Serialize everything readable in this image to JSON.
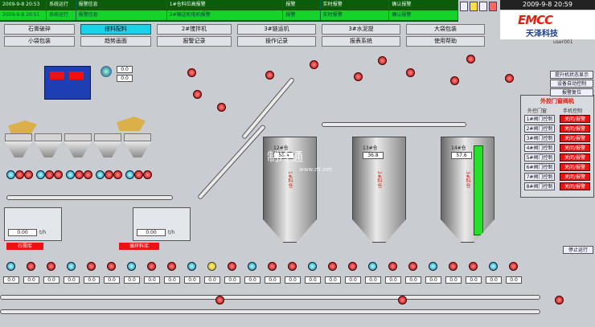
{
  "alarm_rows": [
    [
      "2009-9-8 20:53",
      "系统运行",
      "报警信息",
      "1#仓料位高报警",
      "报警",
      "实时报警",
      "确认报警"
    ],
    [
      "2009-9-8 20:51",
      "系统运行",
      "报警信息",
      "2#输送机电机报警",
      "报警",
      "实时报警",
      "确认报警"
    ]
  ],
  "clock": "2009-9-8 20:59",
  "logo": {
    "brand": "EMCC",
    "cn": "天泽科技",
    "user": "user001"
  },
  "nav": [
    [
      "石膏破碎",
      "搭料配料",
      "2#搅拌机",
      "3#链运机",
      "3#水泥提",
      "大袋包装"
    ],
    [
      "小袋包装",
      "趋势画面",
      "报警记录",
      "操作记录",
      "报表系统",
      "使用帮助"
    ]
  ],
  "selected_nav": "搭料配料",
  "silos": [
    {
      "top": "12#仓",
      "val": "58.4",
      "unit": "t",
      "tag": "1#料仓"
    },
    {
      "top": "13#仓",
      "val": "36.8",
      "unit": "t",
      "tag": "2#料仓"
    },
    {
      "top": "14#仓",
      "val": "57.6",
      "unit": "t",
      "tag": "3#料仓"
    }
  ],
  "panel": {
    "title": "外控门窗阀机",
    "headers": [
      "外控门窗",
      "手机控制"
    ],
    "rows": [
      "1#阀门控制",
      "2#阀门控制",
      "3#阀门控制",
      "4#阀门控制",
      "5#阀门控制",
      "6#阀门控制",
      "7#阀门控制",
      "8#阀门控制"
    ],
    "state": "关闭/报警"
  },
  "small_btns": [
    "提升机状态显示",
    "设备自动控制",
    "报警复位"
  ],
  "belt_labels": {
    "left": "石膏库",
    "mid": "循环料库",
    "stop": "停止运行"
  },
  "weigh": {
    "v1": "0.00",
    "u": "t/h",
    "v2": "0.00"
  },
  "watermark": {
    "cn": "制冷通",
    "url": "www.zlt.net"
  },
  "icons": [
    "print-icon",
    "alarm-icon",
    "user-icon",
    "exit-icon"
  ]
}
